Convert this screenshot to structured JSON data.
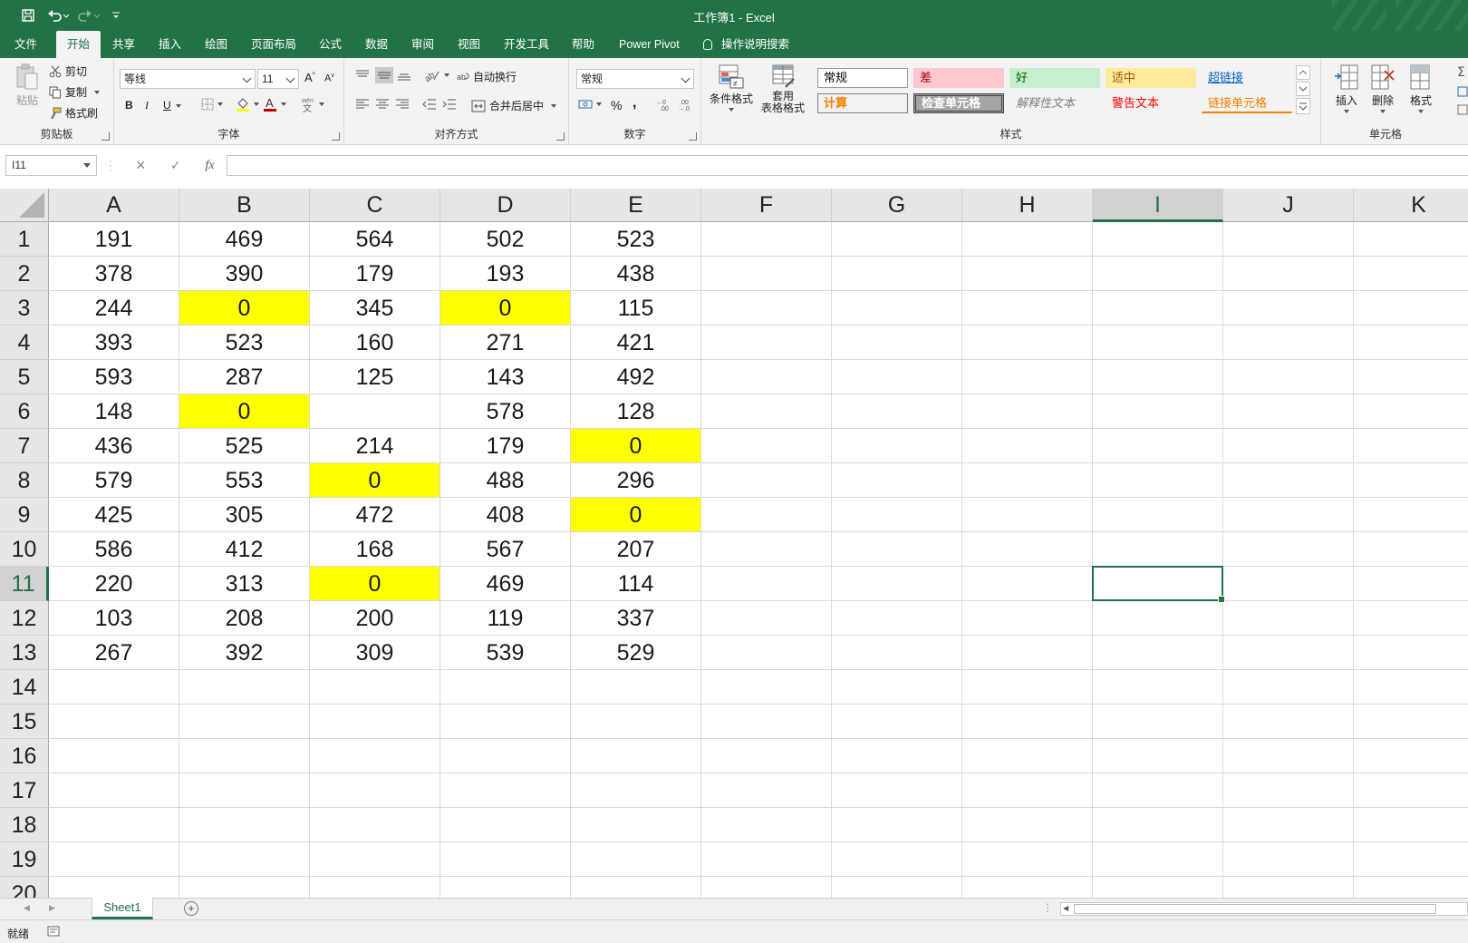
{
  "window": {
    "title": "工作簿1  -  Excel"
  },
  "menu": {
    "tabs": [
      "文件",
      "开始",
      "共享",
      "插入",
      "绘图",
      "页面布局",
      "公式",
      "数据",
      "审阅",
      "视图",
      "开发工具",
      "帮助",
      "Power Pivot"
    ],
    "active_tab": "开始",
    "tell_me": "操作说明搜索"
  },
  "ribbon": {
    "clipboard": {
      "label": "剪贴板",
      "paste": "粘贴",
      "cut": "剪切",
      "copy": "复制",
      "format_painter": "格式刷"
    },
    "font": {
      "label": "字体",
      "name": "等线",
      "size": "11",
      "bold": "B",
      "italic": "I",
      "underline": "U"
    },
    "alignment": {
      "label": "对齐方式",
      "wrap_text": "自动换行",
      "merge_center": "合并后居中"
    },
    "number": {
      "label": "数字",
      "format": "常规",
      "percent": "%",
      "comma": ","
    },
    "styles": {
      "label": "样式",
      "conditional_format": "条件格式",
      "format_as_table_1": "套用",
      "format_as_table_2": "表格格式",
      "gallery": [
        {
          "text": "常规",
          "bg": "#ffffff",
          "color": "#000000"
        },
        {
          "text": "差",
          "bg": "#ffc7ce",
          "color": "#9c0006"
        },
        {
          "text": "好",
          "bg": "#c6efce",
          "color": "#006100"
        },
        {
          "text": "适中",
          "bg": "#ffeb9c",
          "color": "#9c5700"
        },
        {
          "text": "超链接",
          "bg": "transparent",
          "color": "#0563c1"
        },
        {
          "text": "计算",
          "bg": "#f2f2f2",
          "color": "#fa7d00"
        },
        {
          "text": "检查单元格",
          "bg": "#a5a5a5",
          "color": "#ffffff"
        },
        {
          "text": "解释性文本",
          "bg": "transparent",
          "color": "#7f7f7f"
        },
        {
          "text": "警告文本",
          "bg": "transparent",
          "color": "#ff0000"
        },
        {
          "text": "链接单元格",
          "bg": "transparent",
          "color": "#fa7d00"
        }
      ]
    },
    "cells": {
      "label": "单元格",
      "insert": "插入",
      "delete": "删除",
      "format": "格式"
    }
  },
  "formula_bar": {
    "name_box": "I11",
    "fx": "fx",
    "formula": ""
  },
  "sheet": {
    "columns": [
      "A",
      "B",
      "C",
      "D",
      "E",
      "F",
      "G",
      "H",
      "I",
      "J",
      "K"
    ],
    "selected_column": "I",
    "selected_row": "11",
    "rows": [
      "1",
      "2",
      "3",
      "4",
      "5",
      "6",
      "7",
      "8",
      "9",
      "10",
      "11",
      "12",
      "13",
      "14",
      "15",
      "16",
      "17",
      "18",
      "19",
      "20"
    ],
    "highlight_color": "#ffff00",
    "data": [
      [
        "191",
        "469",
        "564",
        "502",
        "523"
      ],
      [
        "378",
        "390",
        "179",
        "193",
        "438"
      ],
      [
        "244",
        "0",
        "345",
        "0",
        "115"
      ],
      [
        "393",
        "523",
        "160",
        "271",
        "421"
      ],
      [
        "593",
        "287",
        "125",
        "143",
        "492"
      ],
      [
        "148",
        "0",
        "",
        "578",
        "128"
      ],
      [
        "436",
        "525",
        "214",
        "179",
        "0"
      ],
      [
        "579",
        "553",
        "0",
        "488",
        "296"
      ],
      [
        "425",
        "305",
        "472",
        "408",
        "0"
      ],
      [
        "586",
        "412",
        "168",
        "567",
        "207"
      ],
      [
        "220",
        "313",
        "0",
        "469",
        "114"
      ],
      [
        "103",
        "208",
        "200",
        "119",
        "337"
      ],
      [
        "267",
        "392",
        "309",
        "539",
        "529"
      ]
    ],
    "highlighted": [
      [
        3,
        "B"
      ],
      [
        3,
        "D"
      ],
      [
        6,
        "B"
      ],
      [
        7,
        "E"
      ],
      [
        8,
        "C"
      ],
      [
        9,
        "E"
      ],
      [
        11,
        "C"
      ]
    ]
  },
  "sheet_tabs": {
    "tabs": [
      "Sheet1"
    ],
    "active": "Sheet1"
  },
  "status": {
    "text": "就绪"
  },
  "colors": {
    "excel_green": "#217346",
    "ribbon_bg": "#f3f3f3"
  }
}
